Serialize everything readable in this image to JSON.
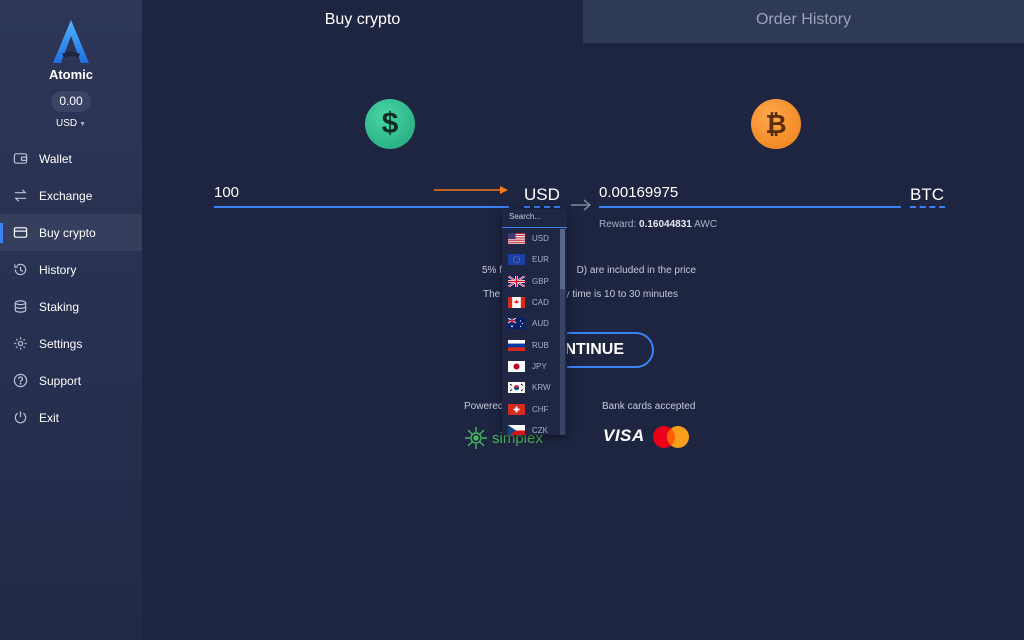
{
  "app": {
    "name": "Atomic",
    "balance": "0.00",
    "currency": "USD"
  },
  "sidebar": {
    "items": [
      {
        "label": "Wallet",
        "icon": "wallet-icon"
      },
      {
        "label": "Exchange",
        "icon": "exchange-icon"
      },
      {
        "label": "Buy crypto",
        "icon": "card-icon",
        "active": true
      },
      {
        "label": "History",
        "icon": "history-icon"
      },
      {
        "label": "Staking",
        "icon": "staking-icon"
      },
      {
        "label": "Settings",
        "icon": "gear-icon"
      },
      {
        "label": "Support",
        "icon": "help-icon"
      },
      {
        "label": "Exit",
        "icon": "power-icon"
      }
    ]
  },
  "tabs": [
    {
      "label": "Buy crypto",
      "active": true
    },
    {
      "label": "Order History",
      "active": false
    }
  ],
  "buy": {
    "from_amount": "100",
    "from_currency": "USD",
    "from_symbol": "$",
    "to_amount": "0.00169975",
    "to_currency": "BTC",
    "to_symbol": "₿",
    "reward_prefix": "Reward:",
    "reward_value": "0.16044831",
    "reward_unit": "AWC",
    "fee_text": "5% fe",
    "fee_text_end": "D) are included in the price",
    "time_text": "The",
    "time_text_end": "ry time is 10 to 30 minutes",
    "continue_label": "NTINUE",
    "powered_label": "Powered",
    "simplex_label": "simplex",
    "bank_label": "Bank cards accepted",
    "visa_label": "VISA"
  },
  "dropdown": {
    "search_placeholder": "Search...",
    "options": [
      "USD",
      "EUR",
      "GBP",
      "CAD",
      "AUD",
      "RUB",
      "JPY",
      "KRW",
      "CHF",
      "CZK"
    ]
  },
  "colors": {
    "accent": "#3b82f6",
    "bg": "#1e2540",
    "sidebar": "#273050",
    "usd_coin": "#2bbd8a",
    "btc_coin": "#f7931a",
    "arrow": "#f07c1c"
  }
}
